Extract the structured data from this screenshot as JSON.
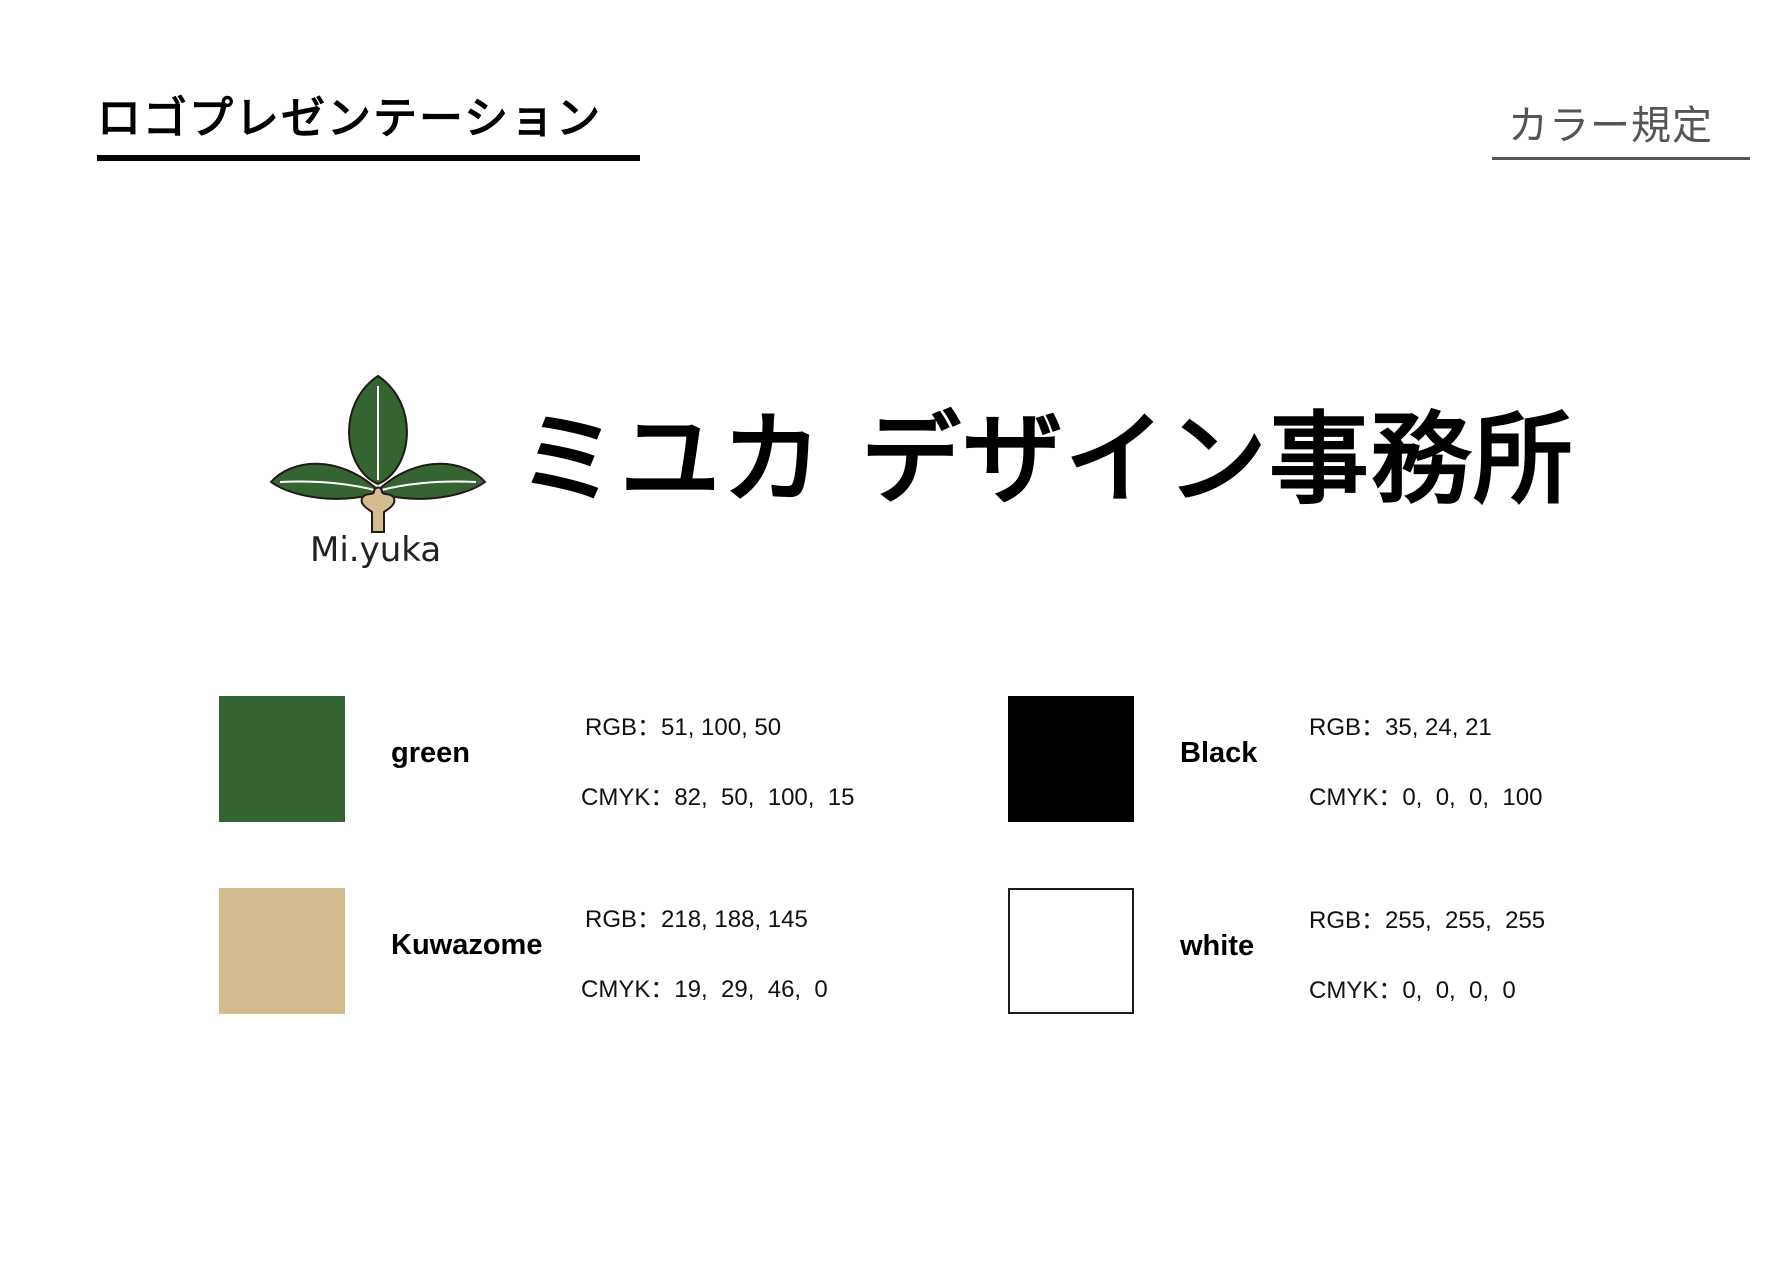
{
  "header": {
    "title": "ロゴプレゼンテーション",
    "section": "カラー規定"
  },
  "logo": {
    "caption": "Mi.yuka",
    "company_name": "ミユカ デザイン事務所"
  },
  "colors": [
    {
      "name": "green",
      "hex": "#336432",
      "rgb": "RGB：51, 100, 50",
      "cmyk": "CMYK：82,  50,  100,  15"
    },
    {
      "name": "Black",
      "hex": "#000000",
      "rgb": "RGB：35, 24, 21",
      "cmyk": "CMYK：0,  0,  0,  100"
    },
    {
      "name": "Kuwazome",
      "hex": "#D4BC91",
      "rgb": "RGB：218, 188, 145",
      "cmyk": "CMYK：19,  29,  46,  0"
    },
    {
      "name": "white",
      "hex": "#FFFFFF",
      "rgb": "RGB：255,  255,  255",
      "cmyk": "CMYK：0,  0,  0,  0"
    }
  ],
  "logo_colors": {
    "leaf": "#336432",
    "trunk": "#D4BC91",
    "outline": "#231815"
  }
}
